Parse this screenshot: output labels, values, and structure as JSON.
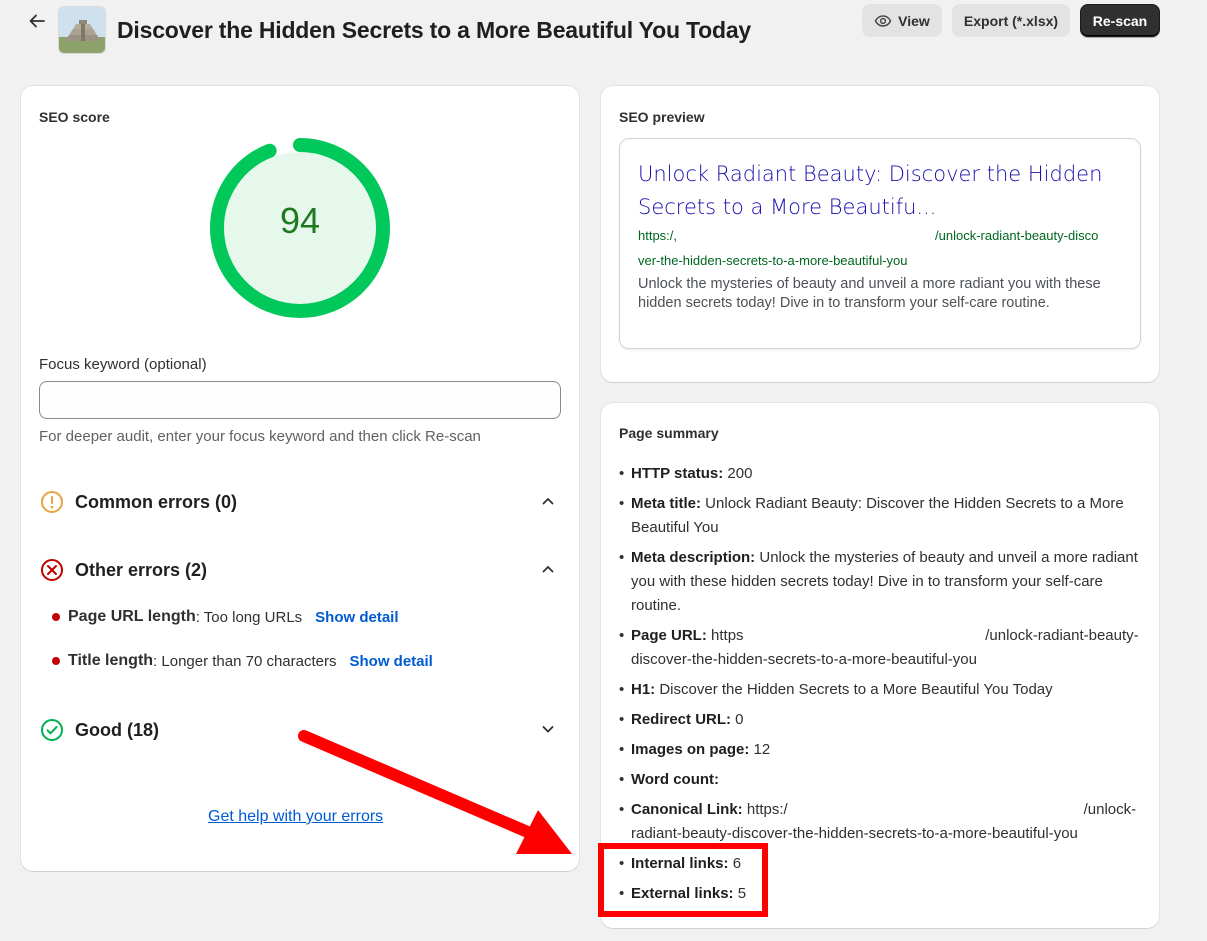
{
  "header": {
    "title": "Discover the Hidden Secrets to a More Beautiful You Today",
    "buttons": {
      "view": "View",
      "export": "Export (*.xlsx)",
      "rescan": "Re-scan"
    }
  },
  "seo_score": {
    "heading": "SEO score",
    "score": "94",
    "score_fraction": 0.94,
    "focus_label": "Focus keyword (optional)",
    "focus_value": "",
    "focus_help": "For deeper audit, enter your focus keyword and then click Re-scan",
    "sections": {
      "common": "Common errors (0)",
      "other": "Other errors (2)",
      "good": "Good (18)"
    },
    "errors": [
      {
        "name": "Page URL length",
        "desc": ": Too long URLs",
        "action": "Show detail"
      },
      {
        "name": "Title length",
        "desc": ": Longer than 70 characters",
        "action": "Show detail"
      }
    ],
    "help_link": "Get help with your errors"
  },
  "seo_preview": {
    "heading": "SEO preview",
    "title": "Unlock Radiant Beauty: Discover the Hidden Secrets to a More Beautifu...",
    "url_line1_start": "https:/,",
    "url_line1_end": "/unlock-radiant-beauty-disco",
    "url_line2": "ver-the-hidden-secrets-to-a-more-beautiful-you",
    "description": "Unlock the mysteries of beauty and unveil a more radiant you with these hidden secrets today! Dive in to transform your self-care routine."
  },
  "page_summary": {
    "heading": "Page summary",
    "items": [
      {
        "label": "HTTP status:",
        "value": " 200"
      },
      {
        "label": "Meta title:",
        "value": " Unlock Radiant Beauty: Discover the Hidden Secrets to a More Beautiful You"
      },
      {
        "label": "Meta description:",
        "value": " Unlock the mysteries of beauty and unveil a more radiant you with these hidden secrets today! Dive in to transform your self-care routine."
      },
      {
        "label": "Page URL:",
        "value": " https                                                          /unlock-radiant-beauty-discover-the-hidden-secrets-to-a-more-beautiful-you"
      },
      {
        "label": "H1:",
        "value": " Discover the Hidden Secrets to a More Beautiful You Today"
      },
      {
        "label": "Redirect URL:",
        "value": " 0"
      },
      {
        "label": "Images on page:",
        "value": " 12"
      },
      {
        "label": "Word count:",
        "value": ""
      },
      {
        "label": "Canonical Link:",
        "value": " https:/                                                                       /unlock-radiant-beauty-discover-the-hidden-secrets-to-a-more-beautiful-you"
      },
      {
        "label": "Internal links:",
        "value": " 6"
      },
      {
        "label": "External links:",
        "value": " 5"
      }
    ]
  },
  "colors": {
    "score_ring": "#00c85a",
    "score_fill": "#e6f8ec",
    "annotation": "#ff0000",
    "link": "#005bd3",
    "serp_title": "#1a0dab",
    "serp_url": "#006621"
  }
}
